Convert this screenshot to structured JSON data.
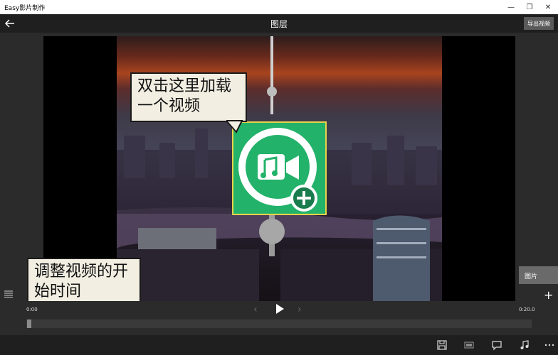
{
  "window": {
    "title": "Easy影片制作",
    "minimize_glyph": "—",
    "maximize_glyph": "❐",
    "close_glyph": "✕"
  },
  "header": {
    "title": "图层",
    "export_label": "导出视频",
    "back_icon": "arrow-left-icon"
  },
  "callouts": {
    "double_click_hint": "双击这里加载一个视频",
    "adjust_start_hint": "调整视频的开始时间"
  },
  "side": {
    "tab_label": "图片",
    "add_glyph": "+"
  },
  "playback": {
    "time_start": "0:00",
    "time_end": "0:20.0",
    "progress_fraction": 0.0
  },
  "bottom_icons": [
    "save-icon",
    "aspect-icon",
    "comment-icon",
    "music-icon",
    "more-icon"
  ],
  "colors": {
    "tile_fill": "#22b26a",
    "tile_border": "#e8d34a",
    "callout_bg": "#f2eee2"
  }
}
